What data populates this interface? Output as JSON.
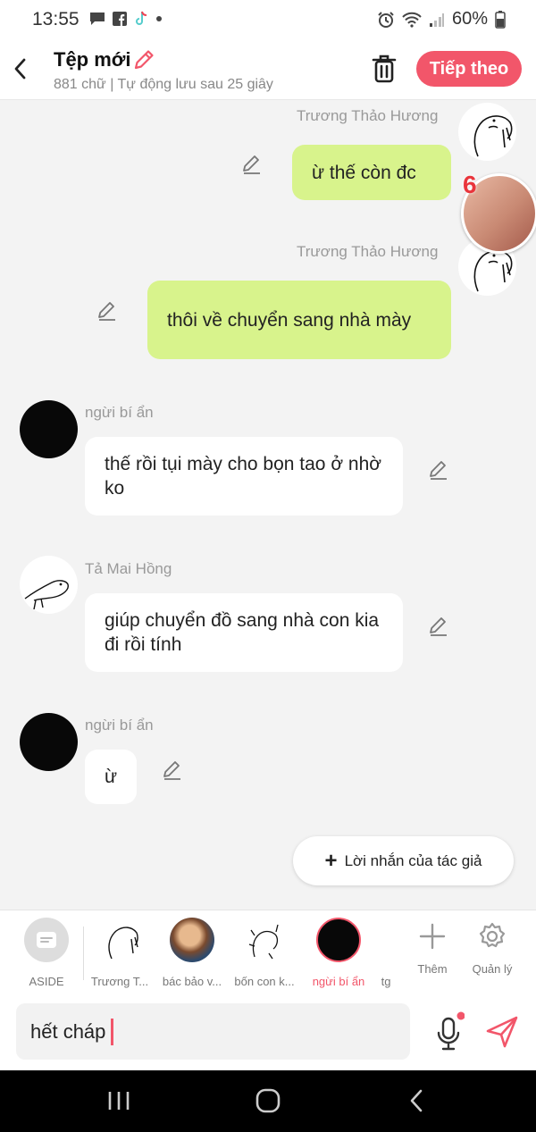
{
  "status_bar": {
    "time": "13:55",
    "battery": "60%"
  },
  "header": {
    "title": "Tệp mới",
    "subtitle": "881 chữ | Tự động lưu sau 25 giây",
    "next_label": "Tiếp theo"
  },
  "messages": [
    {
      "sender": "Trương Thảo Hương",
      "text": "ừ thế còn đc",
      "side": "right"
    },
    {
      "sender": "Trương Thảo Hương",
      "text": "thôi về chuyển sang nhà mày",
      "side": "right"
    },
    {
      "sender": "ngừi bí ẩn",
      "text": "thế rồi tụi mày cho bọn tao ở nhờ ko",
      "side": "left"
    },
    {
      "sender": "Tả Mai Hồng",
      "text": "giúp chuyển đồ sang nhà con kia đi rồi tính",
      "side": "left"
    },
    {
      "sender": "ngừi bí ẩn",
      "text": "ừ",
      "side": "left"
    }
  ],
  "floating_badge": {
    "count": "6"
  },
  "author_note_label": "Lời nhắn của tác giả",
  "characters": [
    {
      "label": "ASIDE",
      "icon": "aside-icon"
    },
    {
      "label": "Trương T...",
      "icon": "sketch-avatar"
    },
    {
      "label": "bác bảo v...",
      "icon": "portrait-avatar"
    },
    {
      "label": "bốn con k...",
      "icon": "sketch-avatar"
    },
    {
      "label": "ngừi bí ẩn",
      "icon": "black-avatar",
      "active": true
    },
    {
      "label": "tg",
      "icon": ""
    }
  ],
  "char_actions": {
    "add_label": "Thêm",
    "manage_label": "Quản lý"
  },
  "input": {
    "value": "hết cháp"
  },
  "colors": {
    "accent": "#f2566a",
    "bubble_right": "#d8f38c",
    "bubble_left": "#ffffff"
  }
}
